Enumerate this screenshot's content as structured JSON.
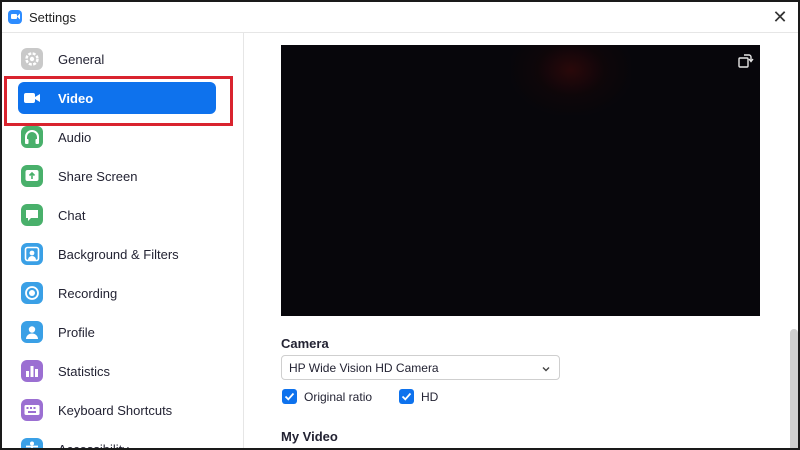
{
  "window": {
    "title": "Settings"
  },
  "colors": {
    "accent": "#0e72ed",
    "highlight_border": "#d9232e",
    "preview_bg": "#07060b"
  },
  "sidebar": {
    "items": [
      {
        "label": "General",
        "icon": "gear-icon",
        "color": "#c9c9c9"
      },
      {
        "label": "Video",
        "icon": "video-camera-icon",
        "color": "#0e72ed",
        "active": true
      },
      {
        "label": "Audio",
        "icon": "headphones-icon",
        "color": "#49b06b"
      },
      {
        "label": "Share Screen",
        "icon": "share-screen-icon",
        "color": "#49b06b"
      },
      {
        "label": "Chat",
        "icon": "chat-bubble-icon",
        "color": "#49b06b"
      },
      {
        "label": "Background & Filters",
        "icon": "background-icon",
        "color": "#3aa0e6"
      },
      {
        "label": "Recording",
        "icon": "record-icon",
        "color": "#3aa0e6"
      },
      {
        "label": "Profile",
        "icon": "profile-icon",
        "color": "#3aa0e6"
      },
      {
        "label": "Statistics",
        "icon": "statistics-icon",
        "color": "#9b6fd2"
      },
      {
        "label": "Keyboard Shortcuts",
        "icon": "keyboard-icon",
        "color": "#9b6fd2"
      },
      {
        "label": "Accessibility",
        "icon": "accessibility-icon",
        "color": "#3aa0e6"
      }
    ]
  },
  "main": {
    "camera_label": "Camera",
    "camera_select": {
      "value": "HP Wide Vision HD Camera"
    },
    "checkboxes": [
      {
        "label": "Original ratio",
        "checked": true
      },
      {
        "label": "HD",
        "checked": true
      }
    ],
    "my_video_label": "My Video"
  }
}
